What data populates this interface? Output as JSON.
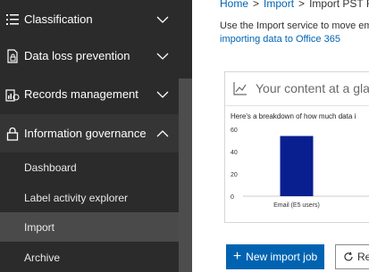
{
  "sidebar": {
    "items": [
      {
        "label": "Classification",
        "icon": "list-icon"
      },
      {
        "label": "Data loss prevention",
        "icon": "document-lock-icon"
      },
      {
        "label": "Records management",
        "icon": "records-icon"
      },
      {
        "label": "Information governance",
        "icon": "lock-icon"
      }
    ],
    "subitems": [
      {
        "label": "Dashboard"
      },
      {
        "label": "Label activity explorer"
      },
      {
        "label": "Import"
      },
      {
        "label": "Archive"
      }
    ]
  },
  "main": {
    "breadcrumb": {
      "home": "Home",
      "import": "Import",
      "current": "Import PST Fi"
    },
    "description": "Use the Import service to move ema",
    "description_link": "importing data to Office 365",
    "card": {
      "title": "Your content at a glanc",
      "subtitle": "Here's a breakdown of how much data i"
    },
    "buttons": {
      "new_import": "New import job",
      "refresh": "Re"
    }
  },
  "chart_data": {
    "type": "bar",
    "categories": [
      "Email (E5 users)"
    ],
    "values": [
      54
    ],
    "yticks": [
      0,
      20,
      40,
      60
    ],
    "ylim": [
      0,
      60
    ],
    "colors": {
      "bar": "#0a1f8f"
    }
  }
}
